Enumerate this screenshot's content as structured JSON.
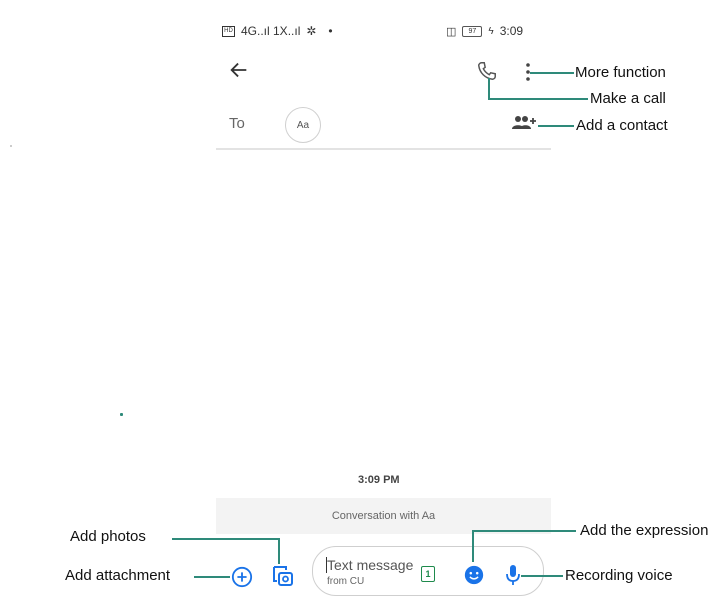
{
  "status_bar": {
    "network": "4G..ıl 1X..ıl",
    "dot": "•",
    "battery_level": "97",
    "time": "3:09"
  },
  "compose": {
    "to_label": "To",
    "recipient_chip": "Aa"
  },
  "conversation": {
    "timestamp": "3:09 PM",
    "banner": "Conversation with Aa"
  },
  "input": {
    "placeholder": "Text message",
    "sim_label": "from CU",
    "sim_number": "1"
  },
  "annotations": {
    "more_function": "More function",
    "make_call": "Make a call",
    "add_contact": "Add a contact",
    "add_photos": "Add photos",
    "add_attachment": "Add attachment",
    "add_expression": "Add the expression",
    "recording_voice": "Recording voice"
  },
  "colors": {
    "accent_blue": "#1a73e8",
    "annotation_line": "#2e8a7a",
    "sim_green": "#1e8a4c"
  }
}
